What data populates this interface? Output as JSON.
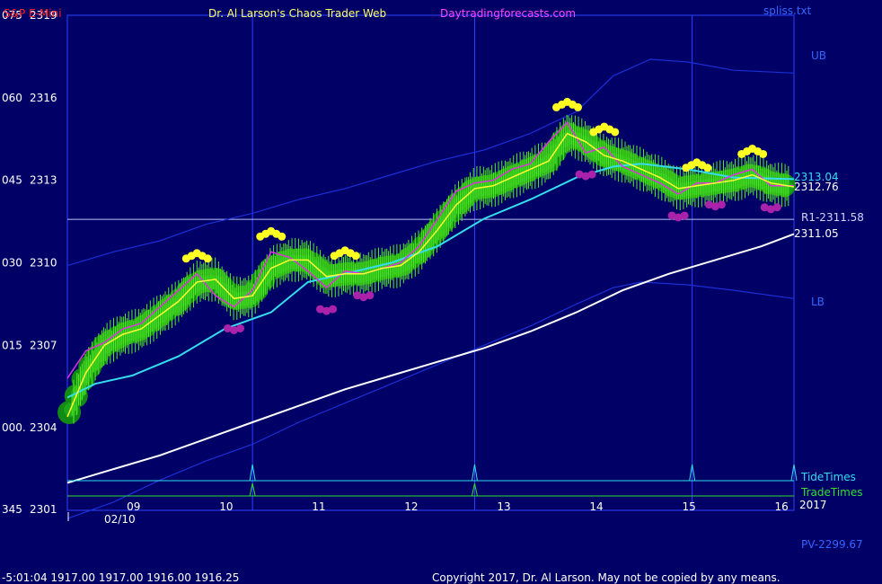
{
  "header": {
    "symbol": "S&P E-Mini",
    "title": "Dr. Al Larson's Chaos Trader Web",
    "site": "Daytradingforecasts.com",
    "file": "spliss.txt",
    "colors": {
      "symbol": "#ff2222",
      "title": "#ffff66",
      "site": "#ff44ff",
      "file": "#3366ff",
      "stamp": "#3366ff"
    }
  },
  "footer": {
    "quote": "-5:01:04  1917.00 1917.00 1916.00 1916.25",
    "copyright": "Copyright 2017, Dr. Al Larson. May not be copied by any means.",
    "pv": "PV-2299.67",
    "year": "2017",
    "date_label": "02/10"
  },
  "chart_data": {
    "type": "line",
    "x_ticks": [
      "09",
      "10",
      "11",
      "12",
      "13",
      "14",
      "15",
      "16"
    ],
    "x_range": [
      8.3,
      16.15
    ],
    "y_range": [
      2301,
      2319
    ],
    "y_ticks": [
      {
        "angle": "345",
        "price": "2301",
        "value": 2301
      },
      {
        "angle": "000.",
        "price": "2304",
        "value": 2304
      },
      {
        "angle": "015",
        "price": "2307",
        "value": 2307
      },
      {
        "angle": "030",
        "price": "2310",
        "value": 2310
      },
      {
        "angle": "045",
        "price": "2313",
        "value": 2313
      },
      {
        "angle": "060",
        "price": "2316",
        "value": 2316
      },
      {
        "angle": "075",
        "price": "2319",
        "value": 2319
      }
    ],
    "levels": {
      "r1": {
        "label": "R1-2311.58",
        "value": 2311.58
      },
      "ub": {
        "label": "UB"
      },
      "lb": {
        "label": "LB"
      }
    },
    "right_labels": {
      "cyan_value": "2313.04",
      "yellow_value": "2312.76",
      "white_value": "2311.05"
    },
    "timing": {
      "tide_label": "TideTimes",
      "trade_label": "TradeTimes",
      "tide_times": [
        10.3,
        12.7,
        15.05,
        16.15
      ],
      "trade_times": [
        10.3,
        12.7
      ]
    },
    "vertical_markers": [
      10.3,
      12.7,
      15.05
    ],
    "series": [
      {
        "key": "ub",
        "color": "#1a2fd6",
        "points": [
          [
            8.3,
            2309.9
          ],
          [
            8.8,
            2310.4
          ],
          [
            9.3,
            2310.8
          ],
          [
            9.8,
            2311.4
          ],
          [
            10.3,
            2311.8
          ],
          [
            10.8,
            2312.3
          ],
          [
            11.3,
            2312.7
          ],
          [
            11.8,
            2313.2
          ],
          [
            12.3,
            2313.7
          ],
          [
            12.8,
            2314.1
          ],
          [
            13.3,
            2314.7
          ],
          [
            13.8,
            2315.5
          ],
          [
            14.2,
            2316.8
          ],
          [
            14.6,
            2317.4
          ],
          [
            15.0,
            2317.3
          ],
          [
            15.5,
            2317.0
          ],
          [
            16.15,
            2316.9
          ]
        ]
      },
      {
        "key": "lb",
        "color": "#1a2fd6",
        "points": [
          [
            8.3,
            2300.7
          ],
          [
            8.8,
            2301.3
          ],
          [
            9.3,
            2302.1
          ],
          [
            9.8,
            2302.8
          ],
          [
            10.3,
            2303.4
          ],
          [
            10.8,
            2304.2
          ],
          [
            11.3,
            2304.9
          ],
          [
            11.8,
            2305.6
          ],
          [
            12.3,
            2306.3
          ],
          [
            12.8,
            2307.0
          ],
          [
            13.3,
            2307.7
          ],
          [
            13.8,
            2308.5
          ],
          [
            14.2,
            2309.1
          ],
          [
            14.5,
            2309.3
          ],
          [
            15.0,
            2309.2
          ],
          [
            15.5,
            2309.0
          ],
          [
            16.15,
            2308.7
          ]
        ]
      },
      {
        "key": "white",
        "color": "#ffffff",
        "points": [
          [
            8.3,
            2302.0
          ],
          [
            8.8,
            2302.5
          ],
          [
            9.3,
            2303.0
          ],
          [
            9.8,
            2303.6
          ],
          [
            10.3,
            2304.2
          ],
          [
            10.8,
            2304.8
          ],
          [
            11.3,
            2305.4
          ],
          [
            11.8,
            2305.9
          ],
          [
            12.3,
            2306.4
          ],
          [
            12.8,
            2306.9
          ],
          [
            13.3,
            2307.5
          ],
          [
            13.8,
            2308.2
          ],
          [
            14.3,
            2309.0
          ],
          [
            14.8,
            2309.6
          ],
          [
            15.3,
            2310.1
          ],
          [
            15.8,
            2310.6
          ],
          [
            16.15,
            2311.05
          ]
        ]
      },
      {
        "key": "cyan",
        "color": "#33ddee",
        "points": [
          [
            8.3,
            2305.1
          ],
          [
            8.6,
            2305.6
          ],
          [
            9.0,
            2305.9
          ],
          [
            9.5,
            2306.6
          ],
          [
            10.0,
            2307.6
          ],
          [
            10.5,
            2308.2
          ],
          [
            10.9,
            2309.3
          ],
          [
            11.3,
            2309.6
          ],
          [
            11.8,
            2310.0
          ],
          [
            12.3,
            2310.6
          ],
          [
            12.8,
            2311.6
          ],
          [
            13.3,
            2312.3
          ],
          [
            13.8,
            2313.1
          ],
          [
            14.2,
            2313.5
          ],
          [
            14.5,
            2313.6
          ],
          [
            15.0,
            2313.4
          ],
          [
            15.5,
            2313.1
          ],
          [
            16.15,
            2313.04
          ]
        ]
      },
      {
        "key": "yellow",
        "color": "#ffff33",
        "points": [
          [
            8.3,
            2304.4
          ],
          [
            8.5,
            2306.0
          ],
          [
            8.7,
            2307.0
          ],
          [
            8.9,
            2307.4
          ],
          [
            9.1,
            2307.6
          ],
          [
            9.3,
            2308.1
          ],
          [
            9.5,
            2308.6
          ],
          [
            9.7,
            2309.3
          ],
          [
            9.9,
            2309.4
          ],
          [
            10.1,
            2308.7
          ],
          [
            10.3,
            2308.8
          ],
          [
            10.5,
            2309.8
          ],
          [
            10.7,
            2310.1
          ],
          [
            10.9,
            2310.1
          ],
          [
            11.1,
            2309.5
          ],
          [
            11.3,
            2309.6
          ],
          [
            11.5,
            2309.6
          ],
          [
            11.7,
            2309.8
          ],
          [
            11.9,
            2309.9
          ],
          [
            12.1,
            2310.4
          ],
          [
            12.3,
            2311.2
          ],
          [
            12.5,
            2312.1
          ],
          [
            12.7,
            2312.7
          ],
          [
            12.9,
            2312.8
          ],
          [
            13.1,
            2313.1
          ],
          [
            13.3,
            2313.4
          ],
          [
            13.5,
            2313.7
          ],
          [
            13.7,
            2314.7
          ],
          [
            13.9,
            2314.4
          ],
          [
            14.1,
            2313.9
          ],
          [
            14.3,
            2313.7
          ],
          [
            14.5,
            2313.4
          ],
          [
            14.7,
            2313.1
          ],
          [
            14.9,
            2312.7
          ],
          [
            15.1,
            2312.8
          ],
          [
            15.3,
            2312.9
          ],
          [
            15.5,
            2313.0
          ],
          [
            15.7,
            2313.2
          ],
          [
            15.9,
            2312.9
          ],
          [
            16.15,
            2312.76
          ]
        ]
      },
      {
        "key": "magenta",
        "color": "#dd33dd",
        "points": [
          [
            8.3,
            2305.8
          ],
          [
            8.5,
            2306.8
          ],
          [
            8.7,
            2307.1
          ],
          [
            8.9,
            2307.6
          ],
          [
            9.1,
            2307.8
          ],
          [
            9.3,
            2308.4
          ],
          [
            9.5,
            2309.0
          ],
          [
            9.7,
            2309.6
          ],
          [
            9.9,
            2308.8
          ],
          [
            10.1,
            2308.4
          ],
          [
            10.3,
            2309.0
          ],
          [
            10.5,
            2310.4
          ],
          [
            10.7,
            2310.2
          ],
          [
            10.9,
            2309.7
          ],
          [
            11.1,
            2309.1
          ],
          [
            11.3,
            2309.7
          ],
          [
            11.5,
            2309.6
          ],
          [
            11.7,
            2309.8
          ],
          [
            11.9,
            2310.0
          ],
          [
            12.1,
            2310.6
          ],
          [
            12.3,
            2311.6
          ],
          [
            12.5,
            2312.6
          ],
          [
            12.7,
            2312.9
          ],
          [
            12.9,
            2313.0
          ],
          [
            13.1,
            2313.4
          ],
          [
            13.3,
            2313.6
          ],
          [
            13.5,
            2314.4
          ],
          [
            13.7,
            2315.1
          ],
          [
            13.9,
            2314.0
          ],
          [
            14.1,
            2314.2
          ],
          [
            14.3,
            2313.5
          ],
          [
            14.5,
            2313.2
          ],
          [
            14.7,
            2312.9
          ],
          [
            14.9,
            2312.5
          ],
          [
            15.1,
            2312.9
          ],
          [
            15.3,
            2312.9
          ],
          [
            15.5,
            2313.2
          ],
          [
            15.7,
            2313.4
          ],
          [
            15.9,
            2312.8
          ],
          [
            16.15,
            2312.8
          ]
        ]
      }
    ]
  }
}
